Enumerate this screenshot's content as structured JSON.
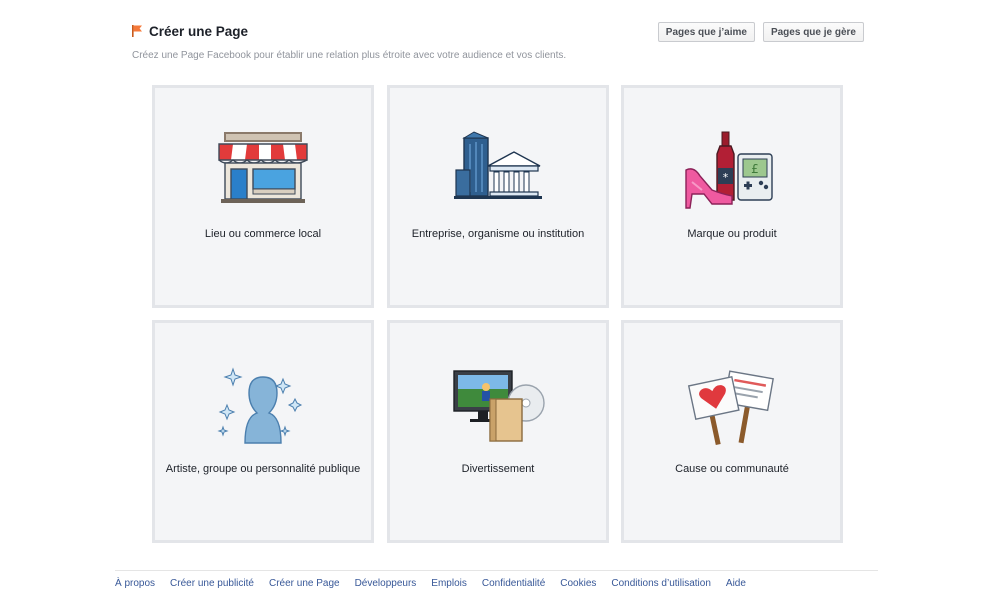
{
  "header": {
    "title": "Créer une Page",
    "subtitle": "Créez une Page Facebook pour établir une relation plus étroite avec votre audience et vos clients.",
    "buttons": [
      "Pages que j’aime",
      "Pages que je gère"
    ],
    "title_icon": "flag-icon",
    "accent_color": "#f5793a"
  },
  "categories": [
    {
      "label": "Lieu ou commerce local",
      "icon": "storefront-icon"
    },
    {
      "label": "Entreprise, organisme ou institution",
      "icon": "office-buildings-icon"
    },
    {
      "label": "Marque ou produit",
      "icon": "products-icon"
    },
    {
      "label": "Artiste, groupe ou personnalité publique",
      "icon": "public-figure-icon"
    },
    {
      "label": "Divertissement",
      "icon": "entertainment-icon"
    },
    {
      "label": "Cause ou communauté",
      "icon": "cause-signs-icon"
    }
  ],
  "footer": {
    "links": [
      "À propos",
      "Créer une publicité",
      "Créer une Page",
      "Développeurs",
      "Emplois",
      "Confidentialité",
      "Cookies",
      "Conditions d’utilisation",
      "Aide"
    ],
    "link_color": "#385898"
  }
}
